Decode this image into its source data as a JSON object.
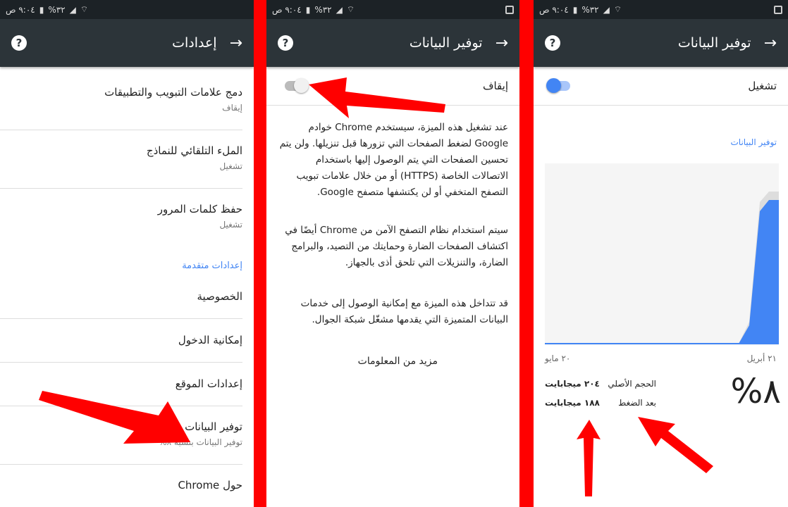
{
  "status": {
    "time": "٩:٠٤ ص",
    "battery": "%٣٢"
  },
  "settings": {
    "title": "إعدادات",
    "items": [
      {
        "label": "دمج علامات التبويب والتطبيقات",
        "sub": "إيقاف"
      },
      {
        "label": "الملء التلقائي للنماذج",
        "sub": "تشغيل"
      },
      {
        "label": "حفظ كلمات المرور",
        "sub": "تشغيل"
      }
    ],
    "section": "إعدادات متقدمة",
    "advanced": [
      {
        "label": "الخصوصية"
      },
      {
        "label": "إمكانية الدخول"
      },
      {
        "label": "إعدادات الموقع"
      },
      {
        "label": "توفير البيانات",
        "sub": "توفير البيانات بنسبة ٨%"
      },
      {
        "label": "حول Chrome"
      }
    ]
  },
  "saver_off": {
    "title": "توفير البيانات",
    "toggle_label": "إيقاف",
    "toggle_on": false,
    "paragraphs": [
      "عند تشغيل هذه الميزة، سيستخدم Chrome خوادم Google لضغط الصفحات التي تزورها قبل تنزيلها. ولن يتم تحسين الصفحات التي يتم الوصول إليها باستخدام الاتصالات الخاصة (HTTPS) أو من خلال علامات تبويب التصفح المتخفي أو لن يكتشفها متصفح Google.",
      "سيتم استخدام نظام التصفح الآمن من Chrome أيضًا في اكتشاف الصفحات الضارة وحمايتك من التصيد، والبرامج الضارة، والتنزيلات التي تلحق أذى بالجهاز.",
      "قد تتداخل هذه الميزة مع إمكانية الوصول إلى خدمات البيانات المتميزة التي يقدمها مشغّل شبكة الجوال."
    ],
    "link": "مزيد من المعلومات"
  },
  "saver_on": {
    "title": "توفير البيانات",
    "toggle_label": "تشغيل",
    "toggle_on": true,
    "section": "توفير البيانات",
    "date_start": "٢١ أبريل",
    "date_end": "٢٠ مايو",
    "percent": "%٨",
    "original_label": "الحجم الأصلي",
    "original_value": "٢٠٤ ميجابايت",
    "compressed_label": "بعد الضغط",
    "compressed_value": "١٨٨ ميجابايت"
  },
  "colors": {
    "accent": "#4285f4",
    "toolbar": "#2c3439",
    "arrow": "#ff0000"
  }
}
